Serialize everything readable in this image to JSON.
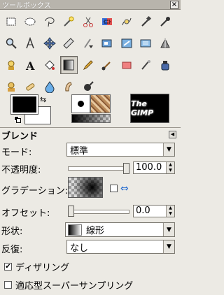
{
  "window": {
    "title": "ツールボックス",
    "close_label": "×"
  },
  "tools": [
    "rect-select-icon",
    "ellipse-select-icon",
    "lasso-icon",
    "fuzzy-select-icon",
    "scissors-icon",
    "color-select-icon",
    "paths-icon",
    "color-picker-icon",
    "eyedropper-icon",
    "magnify-icon",
    "text-tool-icon",
    "move-icon",
    "crop-icon",
    "rotate-icon",
    "scale-icon",
    "shear-icon",
    "perspective-icon",
    "flip-icon",
    "measure-icon",
    "text-icon",
    "bucket-fill-icon",
    "blend-icon",
    "pencil-icon",
    "paintbrush-icon",
    "eraser-icon",
    "airbrush-icon",
    "ink-icon",
    "clone-icon",
    "heal-icon",
    "convolve-icon",
    "smudge-icon",
    "dodge-burn-icon"
  ],
  "colors": {
    "fg": "#000000",
    "bg": "#ffffff"
  },
  "image_thumb_label": "The GIMP",
  "options": {
    "title": "ブレンド",
    "mode_label": "モード:",
    "mode_value": "標準",
    "opacity_label": "不透明度:",
    "opacity_value": "100.0",
    "opacity_fraction": 1.0,
    "gradient_label": "グラデーション:",
    "offset_label": "オフセット:",
    "offset_value": "0.0",
    "offset_fraction": 0.0,
    "shape_label": "形状:",
    "shape_value": "線形",
    "repeat_label": "反復:",
    "repeat_value": "なし",
    "dither_label": "ディザリング",
    "dither_checked": true,
    "adaptive_label": "適応型スーパーサンプリング",
    "adaptive_checked": false
  }
}
